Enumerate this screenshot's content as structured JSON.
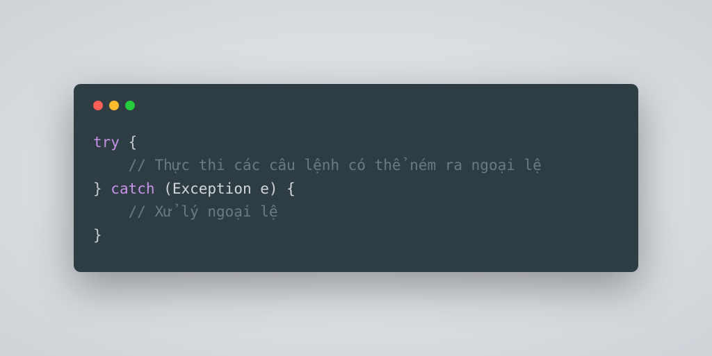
{
  "window": {
    "controls": {
      "close": "red",
      "minimize": "yellow",
      "maximize": "green"
    }
  },
  "code": {
    "line1_try": "try",
    "line1_brace": " {",
    "line2_indent": "    ",
    "line2_comment": "// Thực thi các câu lệnh có thể ném ra ngoại lệ",
    "line3_closebrace": "} ",
    "line3_catch": "catch",
    "line3_paren_open": " (",
    "line3_exception": "Exception e",
    "line3_paren_close": ") {",
    "line4_indent": "    ",
    "line4_comment": "// Xử lý ngoại lệ",
    "line5_closebrace": "}"
  }
}
